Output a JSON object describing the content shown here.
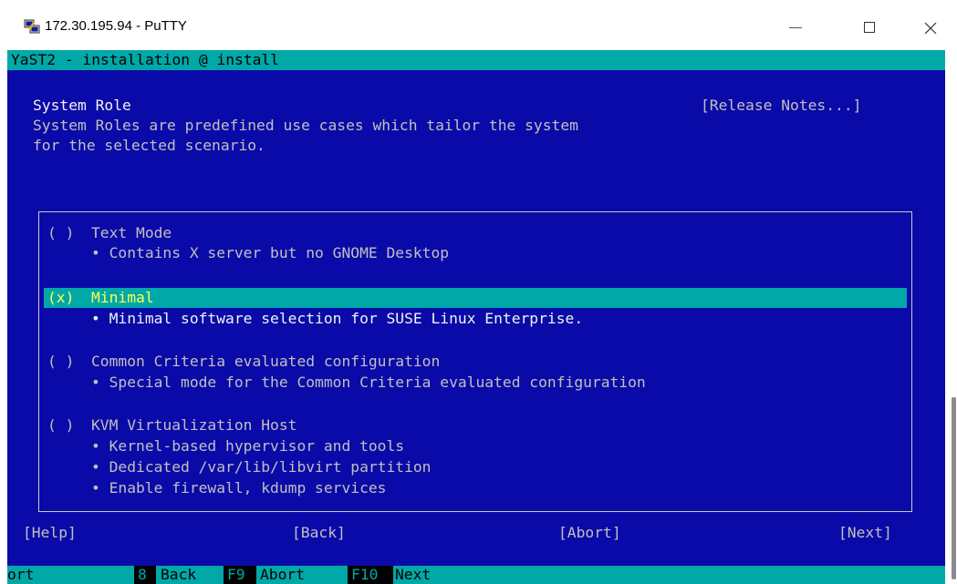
{
  "window": {
    "title": "172.30.195.94 - PuTTY",
    "icon": "putty-icon",
    "controls": [
      "minimize-icon",
      "maximize-icon",
      "close-icon"
    ]
  },
  "terminal": {
    "header": "YaST2 - installation @ install",
    "page_title": "System Role",
    "release_notes": "[Release Notes...]",
    "description_line1": "System Roles are predefined use cases which tailor the system",
    "description_line2": "for the selected scenario.",
    "roles": [
      {
        "marker": "( )",
        "label": "Text Mode",
        "selected": false,
        "details": [
          "• Contains X server but no GNOME Desktop"
        ]
      },
      {
        "marker": "(x)",
        "label": "Minimal",
        "selected": true,
        "details": [
          "• Minimal software selection for SUSE Linux Enterprise."
        ]
      },
      {
        "marker": "( )",
        "label": "Common Criteria evaluated configuration",
        "selected": false,
        "details": [
          "• Special mode for the Common Criteria evaluated configuration"
        ]
      },
      {
        "marker": "( )",
        "label": "KVM Virtualization Host",
        "selected": false,
        "details": [
          "• Kernel-based hypervisor and tools",
          "• Dedicated /var/lib/libvirt partition",
          "• Enable firewall, kdump services"
        ]
      }
    ],
    "buttons": {
      "help": "[Help]",
      "back": "[Back]",
      "abort": "[Abort]",
      "next": "[Next]"
    },
    "fkeys": {
      "prefix": "ort",
      "f8_key": "8",
      "f8_label": "Back",
      "f9_key": "F9",
      "f9_label": "Abort",
      "f10_key": "F10",
      "f10_label": "Next"
    }
  },
  "colors": {
    "terminal_background": "#0a0aa8",
    "header_background": "#00a8a8",
    "selected_row": "#00a8a8",
    "selected_text": "#ffff55"
  }
}
